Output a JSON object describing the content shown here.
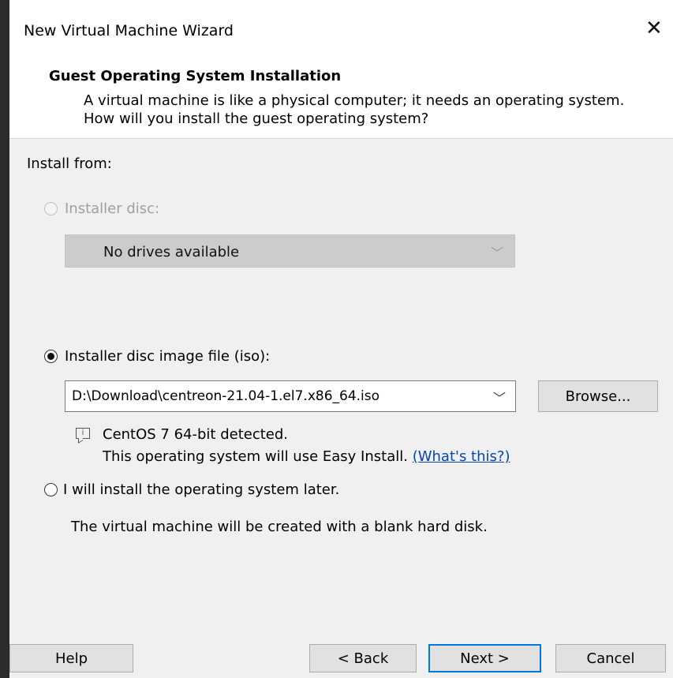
{
  "window": {
    "title": "New Virtual Machine Wizard",
    "close_symbol": "✕"
  },
  "header": {
    "heading": "Guest Operating System Installation",
    "description": "A virtual machine is like a physical computer; it needs an operating system. How will you install the guest operating system?"
  },
  "install_from": {
    "label": "Install from:",
    "installer_disc": {
      "label": "Installer disc:",
      "selected": false,
      "enabled": false,
      "drive_value": "No drives available"
    },
    "iso": {
      "label": "Installer disc image file (iso):",
      "selected": true,
      "path_value": "D:\\Download\\centreon-21.04-1.el7.x86_64.iso",
      "browse_label": "Browse...",
      "detected_text": "CentOS 7 64-bit detected.",
      "easy_install_text": "This operating system will use Easy Install.",
      "whats_this_link": "(What's this?)",
      "info_icon": "info-icon"
    },
    "later": {
      "label": "I will install the operating system later.",
      "selected": false,
      "note": "The virtual machine will be created with a blank hard disk."
    }
  },
  "footer": {
    "help_label": "Help",
    "back_label": "< Back",
    "next_label": "Next >",
    "cancel_label": "Cancel"
  },
  "colors": {
    "accent": "#0078d7",
    "link": "#0645ad",
    "disabled_text": "#a0a0a0"
  }
}
